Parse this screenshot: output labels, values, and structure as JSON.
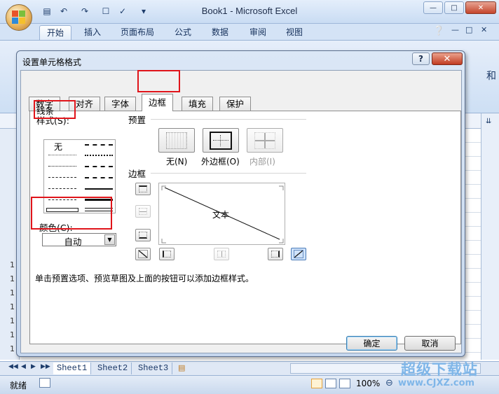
{
  "window": {
    "title": "Book1 - Microsoft Excel",
    "minimize_glyph": "▭",
    "restore_glyph": "▭",
    "close_glyph": "✕"
  },
  "ribbon": {
    "tabs": [
      "开始",
      "插入",
      "页面布局",
      "公式",
      "数据",
      "审阅",
      "视图"
    ],
    "partial_right_text": "和"
  },
  "dialog": {
    "title": "设置单元格格式",
    "help_glyph": "?",
    "close_glyph": "✕",
    "tabs": [
      "数字",
      "对齐",
      "字体",
      "边框",
      "填充",
      "保护"
    ],
    "selected_tab": "边框",
    "line_group_label": "线条",
    "style_label": "样式(S):",
    "none_style": "无",
    "color_label": "颜色(C):",
    "color_value": "自动",
    "presets_label": "预置",
    "preset_none": "无(N)",
    "preset_outline": "外边框(O)",
    "preset_inside": "内部(I)",
    "border_label": "边框",
    "preview_text": "文本",
    "hint": "单击预置选项、预览草图及上面的按钮可以添加边框样式。",
    "ok": "确定",
    "cancel": "取消"
  },
  "sheets": [
    "Sheet1",
    "Sheet2",
    "Sheet3"
  ],
  "status": {
    "ready": "就绪",
    "zoom": "100%"
  },
  "watermark": {
    "line1": "超级下载站",
    "line2": "www.CJXZ.com"
  },
  "colors": {
    "highlight_red": "#e0141a",
    "dialog_frame": "#c6d7ee",
    "ribbon_blue": "#d4e3f6"
  }
}
